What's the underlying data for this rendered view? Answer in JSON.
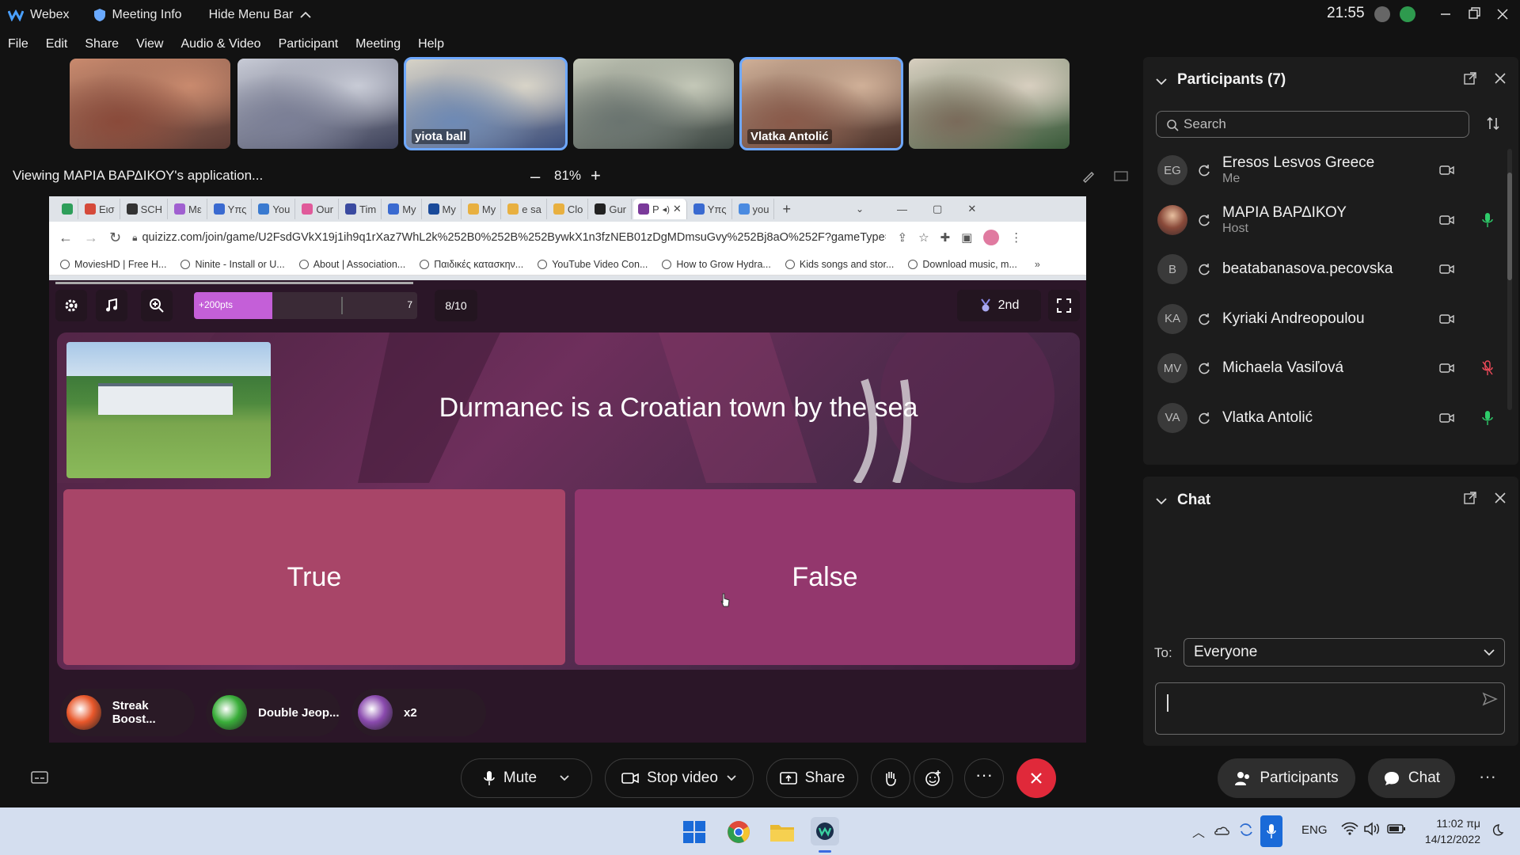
{
  "topbar": {
    "app_name": "Webex",
    "meeting_info": "Meeting Info",
    "hide_menu": "Hide Menu Bar",
    "time": "21:55"
  },
  "menu": [
    "File",
    "Edit",
    "Share",
    "View",
    "Audio & Video",
    "Participant",
    "Meeting",
    "Help"
  ],
  "thumbnails": [
    {
      "name": "",
      "colors": [
        "#8a4a3a",
        "#c98a6e",
        "#5a3a34"
      ]
    },
    {
      "name": "",
      "colors": [
        "#7b7f96",
        "#c8cbd6",
        "#3d4159"
      ]
    },
    {
      "name": "yiota ball",
      "colors": [
        "#6e8ab5",
        "#d8d4c8",
        "#3b4d7a"
      ]
    },
    {
      "name": "",
      "colors": [
        "#6a7470",
        "#c4c8b8",
        "#3a4440"
      ]
    },
    {
      "name": "Vlatka Antolić",
      "colors": [
        "#8a5a4a",
        "#d0b098",
        "#4a3028"
      ]
    },
    {
      "name": "",
      "colors": [
        "#7a6a5a",
        "#d8cfc0",
        "#3a5a3a"
      ]
    }
  ],
  "viewing": {
    "text": "Viewing ΜΑΡΙΑ ΒΑΡΔΙΚΟΥ's application...",
    "zoom": "81%"
  },
  "browser": {
    "tabs": [
      {
        "label": "",
        "color": "#2e9e5a"
      },
      {
        "label": "Εισ",
        "color": "#d54a3a"
      },
      {
        "label": "SCH",
        "color": "#333333"
      },
      {
        "label": "Με",
        "color": "#a060d0"
      },
      {
        "label": "Υπς",
        "color": "#3a6ad0"
      },
      {
        "label": "You",
        "color": "#3a7ad0"
      },
      {
        "label": "Our",
        "color": "#e05a9a"
      },
      {
        "label": "Tim",
        "color": "#3a4aa0"
      },
      {
        "label": "My",
        "color": "#3a6ad0"
      },
      {
        "label": "My",
        "color": "#1a4a9a"
      },
      {
        "label": "My",
        "color": "#e8b040"
      },
      {
        "label": "e sa",
        "color": "#e8b040"
      },
      {
        "label": "Clo",
        "color": "#e8b040"
      },
      {
        "label": "Gur",
        "color": "#222222"
      },
      {
        "label": "P",
        "color": "#7a3a9a"
      },
      {
        "label": "Υπς",
        "color": "#3a6ad0"
      },
      {
        "label": "you",
        "color": "#4a8ae0"
      }
    ],
    "url": "quizizz.com/join/game/U2FsdGVkX19j1ih9q1rXaz7WhL2k%252B0%252B%252BywkX1n3fzNEB01zDgMDmsuGvy%252Bj8aO%252F?gameType=solo",
    "bookmarks": [
      "MoviesHD | Free H...",
      "Ninite - Install or U...",
      "About | Association...",
      "Παιδικές κατασκην...",
      "YouTube Video Con...",
      "How to Grow Hydra...",
      "Kids songs and stor...",
      "Download music, m..."
    ]
  },
  "quiz": {
    "points": "+200pts",
    "streak": "7",
    "streak_progress": 0.35,
    "question_count": "8/10",
    "rank": "2nd",
    "question": "Durmanec is a Croatian town by the sea",
    "answers": [
      "True",
      "False"
    ],
    "powerups": [
      {
        "label": "Streak Boost...",
        "color": "#e8572a"
      },
      {
        "label": "Double Jeop...",
        "color": "#3aae3a"
      },
      {
        "label": "x2",
        "color": "#8a4aae"
      }
    ]
  },
  "participants": {
    "title": "Participants (7)",
    "search_placeholder": "Search",
    "list": [
      {
        "initials": "EG",
        "name": "Eresos Lesvos Greece",
        "role": "Me",
        "mic": "none"
      },
      {
        "initials": "",
        "name": "ΜΑΡΙΑ ΒΑΡΔΙΚΟΥ",
        "role": "Host",
        "mic": "on"
      },
      {
        "initials": "B",
        "name": "beatabanasova.pecovska",
        "role": "",
        "mic": "none"
      },
      {
        "initials": "KA",
        "name": "Kyriaki Andreopoulou",
        "role": "",
        "mic": "none"
      },
      {
        "initials": "MV",
        "name": "Michaela Vasiľová",
        "role": "",
        "mic": "muted"
      },
      {
        "initials": "VA",
        "name": "Vlatka Antolić",
        "role": "",
        "mic": "on"
      }
    ]
  },
  "chat": {
    "title": "Chat",
    "to_label": "To:",
    "to_value": "Everyone"
  },
  "controls": {
    "mute": "Mute",
    "stop_video": "Stop video",
    "share": "Share",
    "participants": "Participants",
    "chat": "Chat"
  },
  "taskbar": {
    "lang": "ENG",
    "time": "11:02 πμ",
    "date": "14/12/2022"
  }
}
